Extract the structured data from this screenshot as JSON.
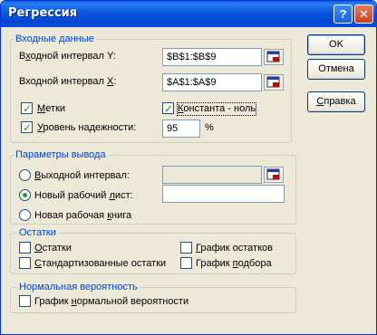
{
  "window": {
    "title": "Регрессия",
    "help_glyph": "?",
    "close_glyph": "✕"
  },
  "input": {
    "legend": "Входные данные",
    "y_label_pre": "В",
    "y_label_u": "х",
    "y_label_post": "одной интервал Y:",
    "y_value": "$B$1:$B$9",
    "x_label_pre": "Входной интервал ",
    "x_label_u": "X",
    "x_label_post": ":",
    "x_value": "$A$1:$A$9",
    "labels_pre": "",
    "labels_u": "М",
    "labels_post": "етки",
    "labels_checked": true,
    "const_zero_pre": "",
    "const_zero_u": "К",
    "const_zero_post": "онстанта - ноль",
    "const_zero_checked": true,
    "confidence_pre": "",
    "confidence_u": "У",
    "confidence_post": "ровень надежности:",
    "confidence_checked": true,
    "confidence_value": "95",
    "percent": "%"
  },
  "output": {
    "legend": "Параметры вывода",
    "range_pre": "",
    "range_u": "В",
    "range_post": "ыходной интервал:",
    "range_value": "",
    "new_sheet_pre": "Новый рабочий ",
    "new_sheet_u": "л",
    "new_sheet_post": "ист:",
    "new_sheet_selected": true,
    "new_sheet_value": "",
    "new_book_pre": "Новая рабочая ",
    "new_book_u": "к",
    "new_book_post": "нига"
  },
  "residuals": {
    "legend": "Остатки",
    "residuals_pre": "",
    "residuals_u": "О",
    "residuals_post": "статки",
    "std_pre": "",
    "std_u": "С",
    "std_post": "тандартизованные остатки",
    "plot_pre": "",
    "plot_u": "Г",
    "plot_post": "рафик остатков",
    "fit_pre": "График ",
    "fit_u": "п",
    "fit_post": "одбора"
  },
  "normal": {
    "legend": "Нормальная вероятность",
    "plot_pre": "График ",
    "plot_u": "н",
    "plot_post": "ормальной вероятности"
  },
  "buttons": {
    "ok": "OK",
    "cancel": "Отмена",
    "help_pre": "",
    "help_u": "С",
    "help_post": "правка"
  },
  "icons": {
    "ref": "range-select-icon",
    "check": "checkmark-icon"
  }
}
